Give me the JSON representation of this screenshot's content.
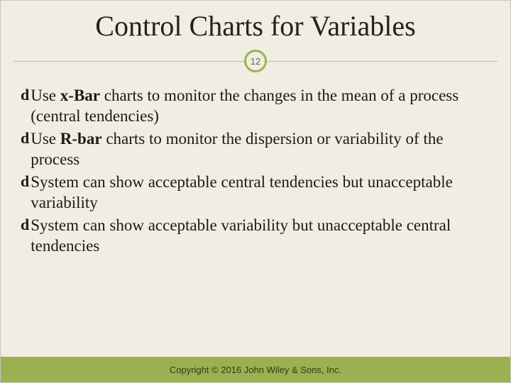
{
  "title": "Control Charts for Variables",
  "page_number": "12",
  "bullets": [
    {
      "html": "Use <b>x-Bar</b>  charts to monitor the changes in the mean of a process (central tendencies)"
    },
    {
      "html": "Use <b>R-bar</b> charts to monitor the dispersion or variability of the process"
    },
    {
      "html": "System can show acceptable central tendencies but unacceptable variability"
    },
    {
      "html": "System can show acceptable variability but unacceptable central tendencies"
    }
  ],
  "footer": "Copyright © 2016 John Wiley & Sons, Inc.",
  "bullet_glyph": "d"
}
